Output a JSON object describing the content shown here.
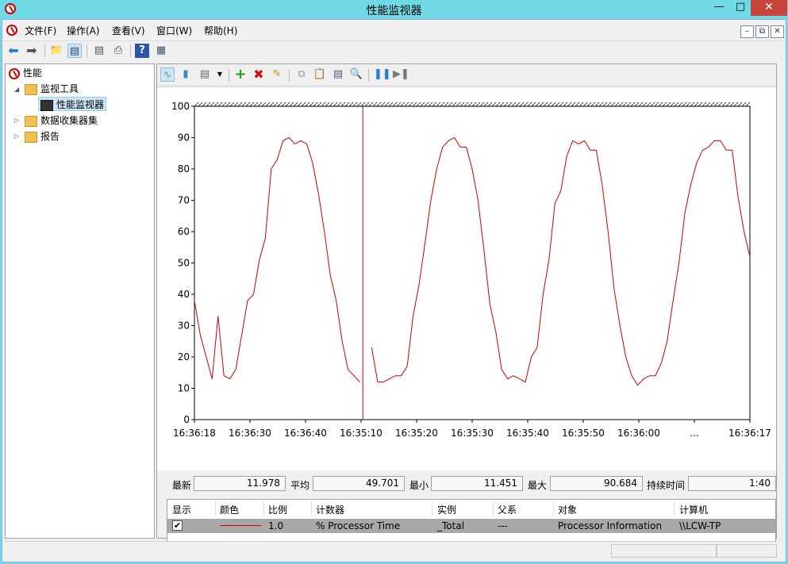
{
  "window": {
    "title": "性能监视器"
  },
  "menu": [
    "文件(F)",
    "操作(A)",
    "查看(V)",
    "窗口(W)",
    "帮助(H)"
  ],
  "tree": {
    "root": "性能",
    "monitoring_tools": "监视工具",
    "perf_monitor": "性能监视器",
    "data_collector_sets": "数据收集器集",
    "reports": "报告"
  },
  "stats": {
    "last_label": "最新",
    "last_value": "11.978",
    "avg_label": "平均",
    "avg_value": "49.701",
    "min_label": "最小",
    "min_value": "11.451",
    "max_label": "最大",
    "max_value": "90.684",
    "duration_label": "持续时间",
    "duration_value": "1:40"
  },
  "legend": {
    "headers": [
      "显示",
      "颜色",
      "比例",
      "计数器",
      "实例",
      "父系",
      "对象",
      "计算机"
    ],
    "row": {
      "show": "✔",
      "color": "#cc0000",
      "scale": "1.0",
      "counter": "% Processor Time",
      "instance": "_Total",
      "parent": "---",
      "object": "Processor Information",
      "computer": "\\\\LCW-TP"
    }
  },
  "chart_data": {
    "type": "line",
    "ylim": [
      0,
      100
    ],
    "yticks": [
      0,
      10,
      20,
      30,
      40,
      50,
      60,
      70,
      80,
      90,
      100
    ],
    "xtick_labels": [
      "16:36:18",
      "16:36:30",
      "16:36:40",
      "16:35:10",
      "16:35:20",
      "16:35:30",
      "16:35:40",
      "16:35:50",
      "16:36:00",
      "...",
      "16:36:17"
    ],
    "series": [
      {
        "color": "#cc0000",
        "segment_a": [
          38,
          27,
          20,
          13,
          33,
          14,
          13,
          16,
          27,
          38,
          40,
          51,
          58,
          80,
          83,
          89,
          90,
          88,
          89,
          88,
          82,
          72,
          60,
          46,
          38,
          25,
          16,
          14,
          12
        ],
        "segment_b": [
          23,
          12,
          12,
          13,
          14,
          14,
          17,
          33,
          43,
          56,
          70,
          80,
          87,
          89,
          90,
          87,
          87,
          80,
          70,
          54,
          37,
          28,
          16,
          13,
          14,
          13,
          12,
          20,
          23,
          40,
          51,
          69,
          73,
          84,
          89,
          88,
          89,
          86,
          86,
          75,
          60,
          42,
          30,
          20,
          14,
          11,
          13,
          14,
          14,
          18,
          25,
          38,
          50,
          66,
          75,
          82,
          86,
          87,
          89,
          89,
          86,
          86,
          71,
          60,
          52
        ]
      }
    ]
  }
}
